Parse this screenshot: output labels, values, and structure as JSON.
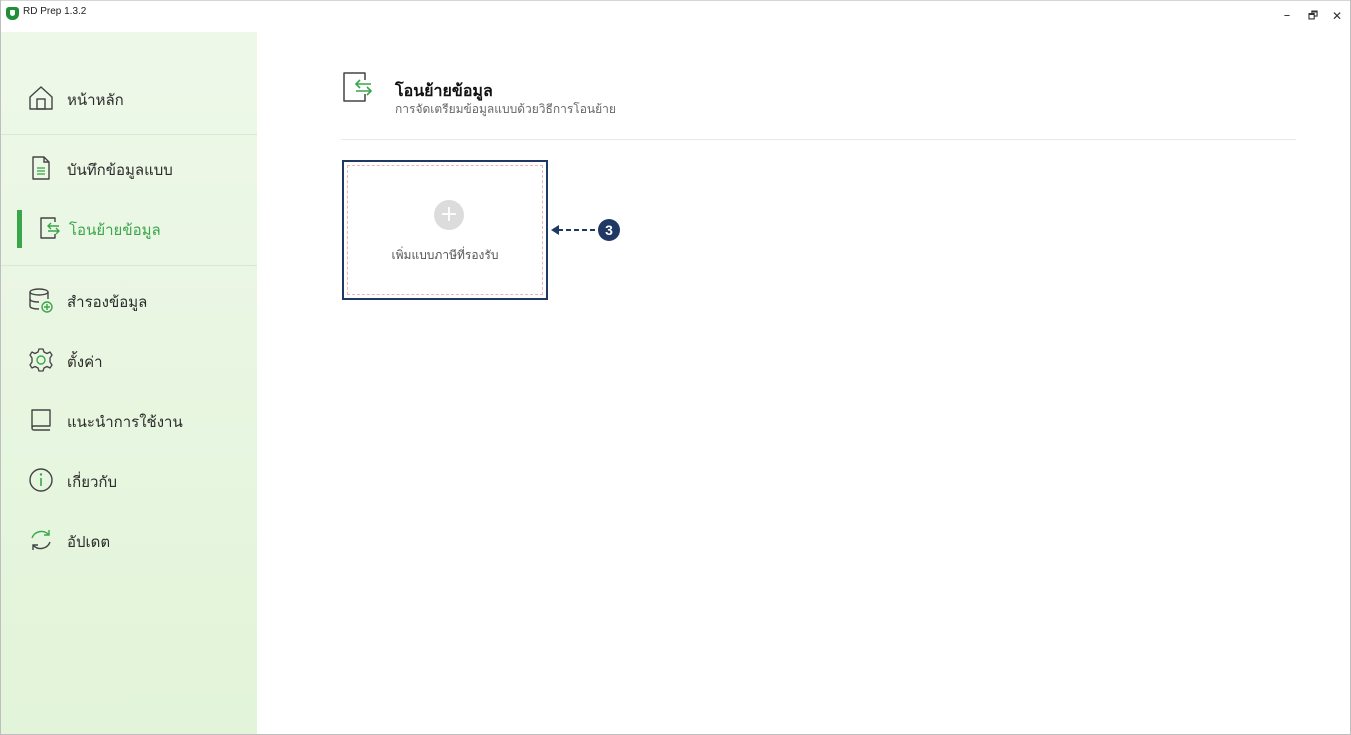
{
  "app": {
    "title": "RD Prep 1.3.2"
  },
  "window_controls": {
    "minimize": "–",
    "restore": "🗗",
    "close": "✕"
  },
  "sidebar": {
    "items": [
      {
        "label": "หน้าหลัก",
        "icon": "home-icon"
      },
      {
        "label": "บันทึกข้อมูลแบบ",
        "icon": "document-icon"
      },
      {
        "label": "โอนย้ายข้อมูล",
        "icon": "transfer-icon",
        "active": true
      },
      {
        "label": "สำรองข้อมูล",
        "icon": "database-add-icon"
      },
      {
        "label": "ตั้งค่า",
        "icon": "gear-icon"
      },
      {
        "label": "แนะนำการใช้งาน",
        "icon": "book-icon"
      },
      {
        "label": "เกี่ยวกับ",
        "icon": "info-icon"
      },
      {
        "label": "อัปเดต",
        "icon": "refresh-icon"
      }
    ]
  },
  "main": {
    "title": "โอนย้ายข้อมูล",
    "subtitle": "การจัดเตรียมข้อมูลแบบด้วยวิธีการโอนย้าย",
    "add_card": {
      "label": "เพิ่มแบบภาษีที่รองรับ",
      "icon": "plus-icon"
    },
    "callout": {
      "number": "3"
    }
  },
  "colors": {
    "accent": "#3aa64a",
    "callout": "#1f3864"
  }
}
